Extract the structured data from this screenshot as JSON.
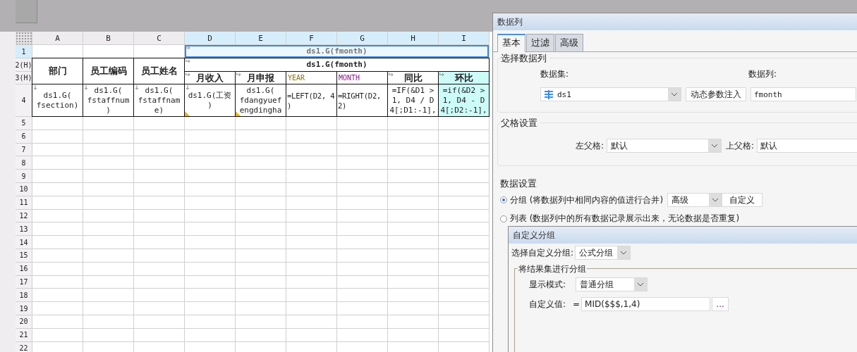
{
  "sheet": {
    "columns": [
      {
        "label": "A",
        "selected": false
      },
      {
        "label": "B",
        "selected": false
      },
      {
        "label": "C",
        "selected": false
      },
      {
        "label": "D",
        "selected": true
      },
      {
        "label": "E",
        "selected": true
      },
      {
        "label": "F",
        "selected": true
      },
      {
        "label": "G",
        "selected": true
      },
      {
        "label": "H",
        "selected": true
      },
      {
        "label": "I",
        "selected": true
      }
    ],
    "rows": [
      {
        "label": "1",
        "selected": true
      },
      {
        "label": "2(H)",
        "selected": false
      },
      {
        "label": "3(H)",
        "selected": false
      },
      {
        "label": "4",
        "selected": false
      },
      {
        "label": "5",
        "selected": false
      },
      {
        "label": "6",
        "selected": false
      },
      {
        "label": "7",
        "selected": false
      },
      {
        "label": "8",
        "selected": false
      },
      {
        "label": "9",
        "selected": false
      },
      {
        "label": "10",
        "selected": false
      },
      {
        "label": "11",
        "selected": false
      },
      {
        "label": "12",
        "selected": false
      },
      {
        "label": "13",
        "selected": false
      },
      {
        "label": "14",
        "selected": false
      },
      {
        "label": "15",
        "selected": false
      },
      {
        "label": "16",
        "selected": false
      },
      {
        "label": "17",
        "selected": false
      },
      {
        "label": "18",
        "selected": false
      },
      {
        "label": "19",
        "selected": false
      },
      {
        "label": "20",
        "selected": false
      },
      {
        "label": "21",
        "selected": false
      },
      {
        "label": "22",
        "selected": false
      }
    ],
    "cells": [
      {
        "kind": "title",
        "text": "ds1.G(fmonth)",
        "selected": true,
        "expand_right": true
      },
      {
        "kind": "header",
        "text": "部门",
        "selected": false
      },
      {
        "kind": "header",
        "text": "员工编码",
        "selected": false
      },
      {
        "kind": "header",
        "text": "员工姓名",
        "selected": false
      },
      {
        "kind": "title",
        "text": "ds1.G(fmonth)",
        "selected": false,
        "expand_right": true
      },
      {
        "kind": "header",
        "text": "月收入",
        "selected": false,
        "expand_right": true
      },
      {
        "kind": "header",
        "text": "月申报",
        "selected": false,
        "expand_right": true
      },
      {
        "kind": "label",
        "text": "YEAR",
        "selected": false,
        "color": "#8a7400"
      },
      {
        "kind": "label",
        "text": "MONTH",
        "selected": false,
        "color": "#8a1a8a"
      },
      {
        "kind": "header",
        "text": "同比",
        "selected": false,
        "expand_right": true
      },
      {
        "kind": "header",
        "text": "环比",
        "selected": false,
        "expand_right": true,
        "highlighted": true
      },
      {
        "kind": "data",
        "text": "ds1.G(\nfsection)",
        "selected": false,
        "expand_down": true
      },
      {
        "kind": "data",
        "text": "ds1.G(\nfstaffnum\n)",
        "selected": false,
        "expand_down": true
      },
      {
        "kind": "data",
        "text": "ds1.G(\nfstaffnam\ne)",
        "selected": false,
        "expand_down": true
      },
      {
        "kind": "data",
        "text": "ds1.G(工资\n)",
        "selected": false,
        "expand_down": true,
        "marked": true
      },
      {
        "kind": "data",
        "text": "ds1.G(\nfdangyuef\nengdingha",
        "selected": false,
        "marked": true
      },
      {
        "kind": "formula",
        "text": "=LEFT(D2, 4\n)",
        "selected": false
      },
      {
        "kind": "formula",
        "text": "=RIGHT(D2,\n2)",
        "selected": false
      },
      {
        "kind": "data",
        "text": "=IF(&D1 >\n1, D4 / D\n4[;D1:-1],",
        "selected": false
      },
      {
        "kind": "data",
        "text": "=if(&D2 >\n1, D4 - D\n4[;D2:-1],",
        "selected": false,
        "highlighted": true
      }
    ]
  },
  "dialog": {
    "title": "数据列",
    "tabs": [
      {
        "label": "基本",
        "selected": true
      },
      {
        "label": "过滤",
        "selected": false
      },
      {
        "label": "高级",
        "selected": false
      }
    ],
    "select_column": {
      "title": "选择数据列",
      "dataset_label": "数据集:",
      "dataset": "ds1",
      "inject_button": "动态参数注入",
      "column_label": "数据列:",
      "column": "fmonth"
    },
    "parent": {
      "title": "父格设置",
      "left_label": "左父格:",
      "left": "默认",
      "top_label": "上父格:",
      "top": "默认"
    },
    "data_settings": {
      "title": "数据设置",
      "options": [
        {
          "label": "分组 (将数据列中相同内容的值进行合并)",
          "selected": true
        },
        {
          "label": "列表 (数据列中的所有数据记录展示出来，无论数据是否重复)",
          "selected": false
        }
      ],
      "group_mode": "高级",
      "custom_button": "自定义"
    }
  },
  "custom_group_dialog": {
    "title": "自定义分组",
    "select_label": "选择自定义分组:",
    "select": "公式分组",
    "group_title": "将结果集进行分组",
    "display_label": "显示模式:",
    "display": "普通分组",
    "value_label": "自定义值:",
    "equals": "=",
    "value": "MID($$$,1,4)",
    "more_button": "..."
  }
}
